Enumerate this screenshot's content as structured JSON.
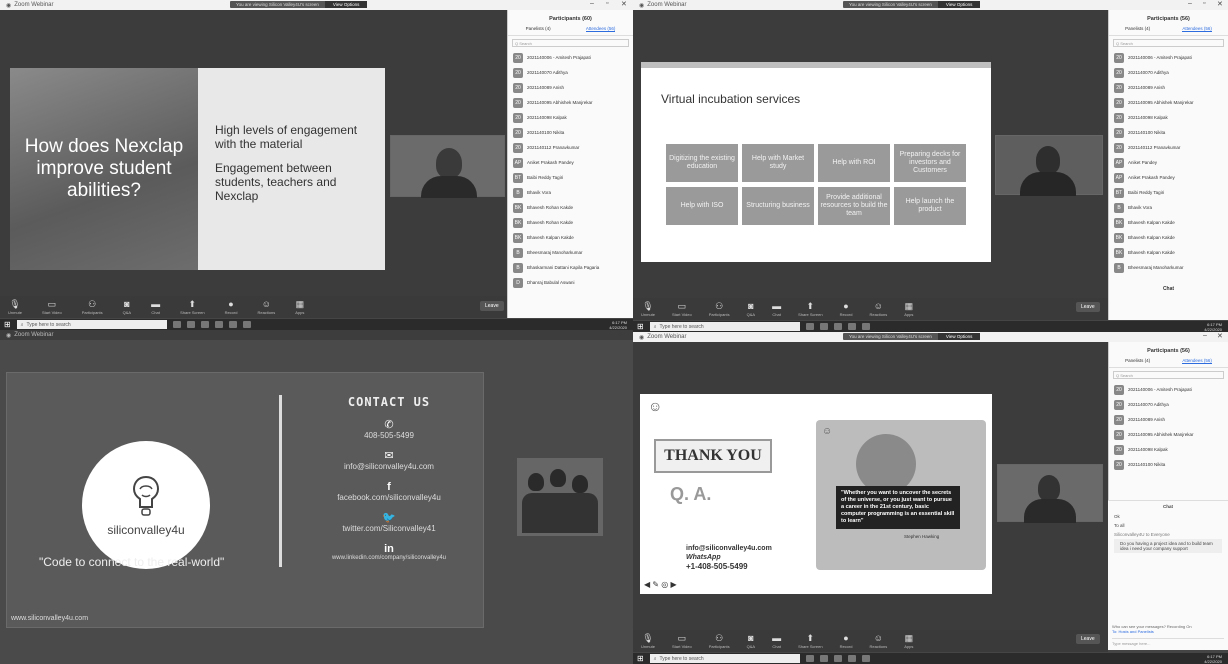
{
  "app_title": "Zoom Webinar",
  "share_banner": {
    "text": "You are viewing Silicon Valley4U's screen",
    "options": "View Options"
  },
  "toolbar": [
    "Unmute",
    "Start Video",
    "Participants",
    "Q&A",
    "Chat",
    "Share Screen",
    "Record",
    "Reactions",
    "Apps"
  ],
  "leave_label": "Leave",
  "taskbar": {
    "search": "Type here to search",
    "time": "6:17 PM",
    "date": "4/22/2020"
  },
  "q1": {
    "slide_left": "How does Nexclap improve student abilities?",
    "slide_right_1": "High levels of engagement with the material",
    "slide_right_2": "Engagement between students, teachers and Nexclap"
  },
  "panel_q1": {
    "title": "Participants (60)",
    "tab1": "Panelists (4)",
    "tab2": "Attendees (56)",
    "search": "Q Search",
    "rows": [
      {
        "initials": "20",
        "name": "2021140006 - Amitesh Prajapati"
      },
      {
        "initials": "20",
        "name": "2021140070 Adithya"
      },
      {
        "initials": "20",
        "name": "2021140089 Anish"
      },
      {
        "initials": "20",
        "name": "2021140095 Abhishek Manjrekar"
      },
      {
        "initials": "20",
        "name": "2021140098 Kalpak"
      },
      {
        "initials": "20",
        "name": "2021140100 Nikita"
      },
      {
        "initials": "20",
        "name": "2021140112 Pranavkumar"
      },
      {
        "initials": "AP",
        "name": "Aniket Prakash Pandey"
      },
      {
        "initials": "BT",
        "name": "Baibi Reddy Tagiri"
      },
      {
        "initials": "B",
        "name": "Bhavik Vora"
      },
      {
        "initials": "BK",
        "name": "Bhavesh Rohan Kakde"
      },
      {
        "initials": "BK",
        "name": "Bhavesh Rohan Kakde"
      },
      {
        "initials": "BK",
        "name": "Bhavesh Kalpan Kakde"
      },
      {
        "initials": "B",
        "name": "Bheesmaraj Manoharkumar"
      },
      {
        "initials": "B",
        "name": "Bhaskarmani Dattani Kapila Pagaria"
      },
      {
        "initials": "D",
        "name": "Dhanraj Babulal Aswani"
      }
    ]
  },
  "q2": {
    "slide_title": "Virtual incubation services",
    "boxes": [
      "Digitizing the existing education",
      "Help with Market study",
      "Help with ROI",
      "Preparing decks for investors and Customers",
      "Help with ISO",
      "Structuring business",
      "Provide additional resources to build the team",
      "Help launch the product"
    ]
  },
  "panel_q2": {
    "title": "Participants (56)",
    "tab1": "Panelists (4)",
    "tab2": "Attendees (56)",
    "search": "Q Search",
    "rows": [
      {
        "initials": "20",
        "name": "2021140006 - Amitesh Prajapati"
      },
      {
        "initials": "20",
        "name": "2021140070 Adithya"
      },
      {
        "initials": "20",
        "name": "2021140089 Anish"
      },
      {
        "initials": "20",
        "name": "2021140095 Abhishek Manjrekar"
      },
      {
        "initials": "20",
        "name": "2021140098 Kalpak"
      },
      {
        "initials": "20",
        "name": "2021140100 Nikita"
      },
      {
        "initials": "20",
        "name": "2021140112 Pranavkumar"
      },
      {
        "initials": "AP",
        "name": "Aniket Pandey"
      },
      {
        "initials": "AP",
        "name": "Aniket Prakash Pandey"
      },
      {
        "initials": "BT",
        "name": "Baibi Reddy Tagiri"
      },
      {
        "initials": "B",
        "name": "Bhavik Vora"
      },
      {
        "initials": "BK",
        "name": "Bhavesh Kalpan Kakde"
      },
      {
        "initials": "BK",
        "name": "Bhavesh Kalpan Kakde"
      },
      {
        "initials": "BK",
        "name": "Bhavesh Kalpan Kakde"
      },
      {
        "initials": "B",
        "name": "Bheesmaraj Manoharkumar"
      }
    ],
    "chat_label": "Chat"
  },
  "q3": {
    "logo_text": "siliconvalley4u",
    "tagline": "\"Code to connect to the real-world\"",
    "contact_title": "CONTACT US",
    "phone": "408-505-5499",
    "email": "info@siliconvalley4u.com",
    "facebook": "facebook.com/siliconvalley4u",
    "twitter": "twitter.com/Siliconvalley41",
    "linkedin": "www.linkedin.com/company/siliconvalley4u",
    "url": "www.siliconvalley4u.com"
  },
  "q4": {
    "thank_you": "THANK YOU",
    "qa": "Q. A.",
    "email": "info@siliconvalley4u.com",
    "whatsapp": "WhatsApp",
    "phone": "+1-408-505-5499",
    "quote": "\"Whether you want to uncover the secrets of the universe, or you just want to pursue a career in the 21st century, basic computer programming is an essential skill to learn\"",
    "author": "Stephen Hawking"
  },
  "panel_q4": {
    "title": "Participants (56)",
    "tab1": "Panelists (4)",
    "tab2": "Attendees (56)",
    "search": "Q Search",
    "rows": [
      {
        "initials": "20",
        "name": "2021140006 - Amitesh Prajapati"
      },
      {
        "initials": "20",
        "name": "2021140070 Adithya"
      },
      {
        "initials": "20",
        "name": "2021140089 Anish"
      },
      {
        "initials": "20",
        "name": "2021140095 Abhishek Manjrekar"
      },
      {
        "initials": "20",
        "name": "2021140098 Kalpak"
      },
      {
        "initials": "20",
        "name": "2021140100 Nikita"
      }
    ]
  },
  "chat": {
    "title": "Chat",
    "messages": [
      "Ok",
      "To all",
      "Siliconvalley4U to Everyone",
      "Do you having a project idea and to build team idea i need your company support"
    ],
    "who_can_see": "Who can see your messages? Recording On",
    "to_label": "To: Hosts and Panelists",
    "input_placeholder": "Type message here..."
  }
}
